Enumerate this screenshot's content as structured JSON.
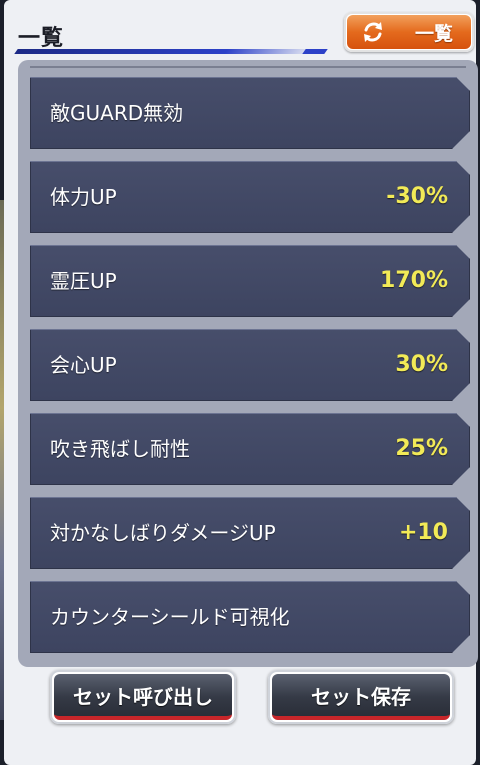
{
  "header": {
    "title": "一覧",
    "list_button": {
      "label": "一覧",
      "icon": "refresh-icon",
      "color": "#e46a1d"
    }
  },
  "effects": [
    {
      "label": "敵GUARD無効",
      "value": ""
    },
    {
      "label": "体力UP",
      "value": "-30%"
    },
    {
      "label": "霊圧UP",
      "value": "170%"
    },
    {
      "label": "会心UP",
      "value": "30%"
    },
    {
      "label": "吹き飛ばし耐性",
      "value": "25%"
    },
    {
      "label": "対かなしばりダメージUP",
      "value": "+10"
    },
    {
      "label": "カウンターシールド可視化",
      "value": ""
    }
  ],
  "footer": {
    "load_set_label": "セット呼び出し",
    "save_set_label": "セット保存"
  },
  "colors": {
    "value_text": "#f2ea57",
    "row_background": "#434a66",
    "accent_underline": "#c8262a",
    "title_bar": "#2c41c8"
  }
}
